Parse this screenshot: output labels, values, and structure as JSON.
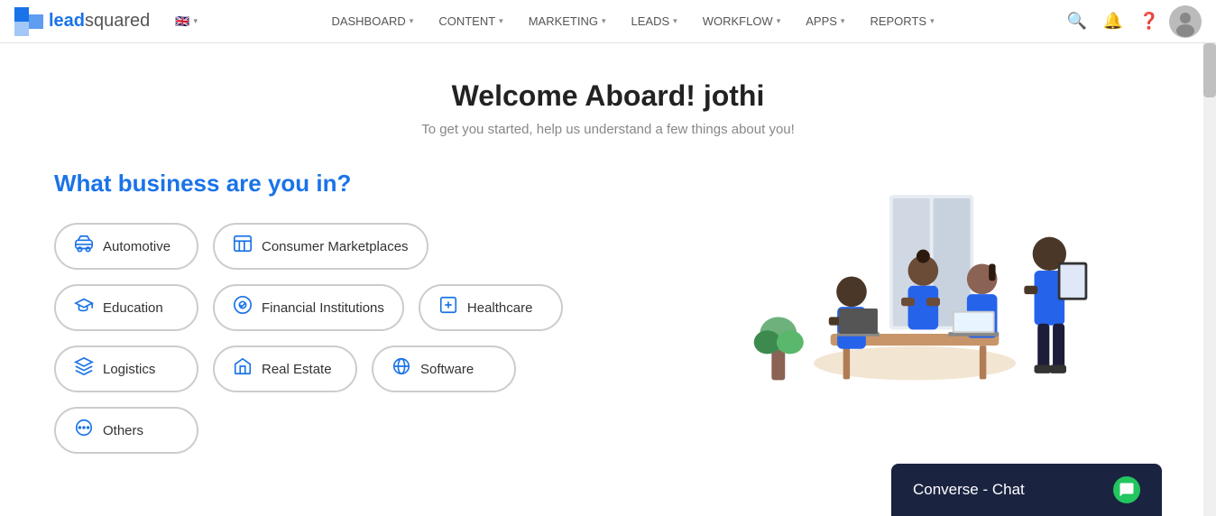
{
  "navbar": {
    "logo_text_lead": "lead",
    "logo_text_squared": "squared",
    "flag": "🇬🇧",
    "items": [
      {
        "label": "DASHBOARD",
        "key": "dashboard"
      },
      {
        "label": "CONTENT",
        "key": "content"
      },
      {
        "label": "MARKETING",
        "key": "marketing"
      },
      {
        "label": "LEADS",
        "key": "leads"
      },
      {
        "label": "WORKFLOW",
        "key": "workflow"
      },
      {
        "label": "APPS",
        "key": "apps"
      },
      {
        "label": "REPORTS",
        "key": "reports"
      }
    ]
  },
  "welcome": {
    "title": "Welcome Aboard! jothi",
    "subtitle": "To get you started, help us understand a few things about you!"
  },
  "business_section": {
    "heading": "What business are you in?",
    "rows": [
      [
        {
          "label": "Automotive",
          "icon": "🚗"
        },
        {
          "label": "Consumer Marketplaces",
          "icon": "🏪"
        }
      ],
      [
        {
          "label": "Education",
          "icon": "🎓"
        },
        {
          "label": "Financial Institutions",
          "icon": "🏦"
        },
        {
          "label": "Healthcare",
          "icon": "🔒"
        }
      ],
      [
        {
          "label": "Logistics",
          "icon": "✈️"
        },
        {
          "label": "Real Estate",
          "icon": "🏠"
        },
        {
          "label": "Software",
          "icon": "🌐"
        }
      ],
      [
        {
          "label": "Others",
          "icon": "⊕"
        }
      ]
    ]
  },
  "converse_chat": {
    "label": "Converse - Chat",
    "icon": "💬"
  }
}
